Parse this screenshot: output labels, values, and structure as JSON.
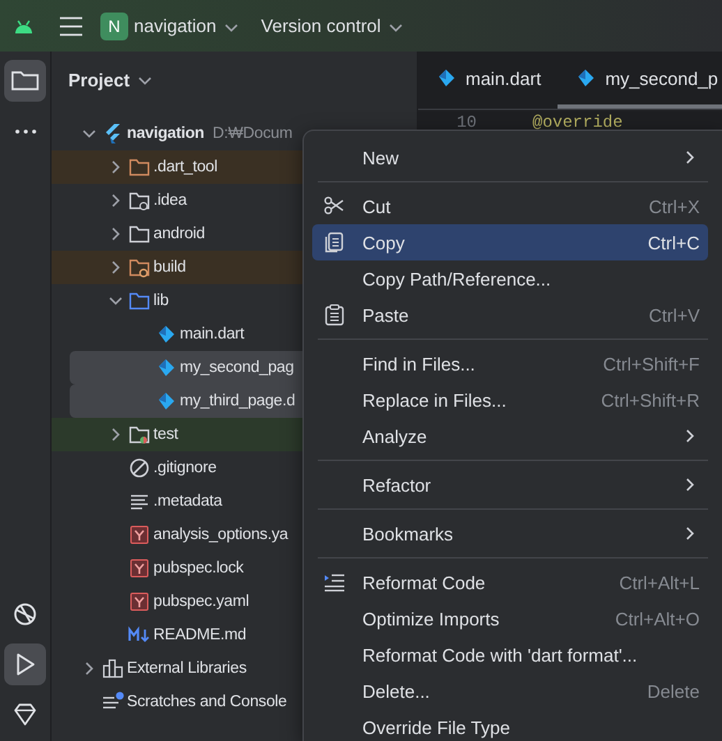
{
  "top_bar": {
    "project_badge": "N",
    "project": "navigation",
    "vcs": "Version control"
  },
  "tool_strip": {
    "top": [
      {
        "kind": "folder",
        "selected": true
      },
      {
        "kind": "more",
        "selected": false
      }
    ],
    "bottom": [
      {
        "kind": "services",
        "selected": false
      },
      {
        "kind": "run",
        "selected": true
      },
      {
        "kind": "gem",
        "selected": false
      }
    ]
  },
  "project": {
    "title": "Project",
    "tree": [
      {
        "label": "navigation",
        "hint": "D:₩Docum",
        "kind": "project",
        "expanded": true,
        "selected": false,
        "excluded": false,
        "test_root": false,
        "children": [
          {
            "label": ".dart_tool",
            "kind": "folder-excluded",
            "expanded": false,
            "selected": false,
            "excluded": true,
            "test_root": false
          },
          {
            "label": ".idea",
            "kind": "folder-config",
            "expanded": false,
            "selected": false,
            "excluded": false,
            "test_root": false
          },
          {
            "label": "android",
            "kind": "folder",
            "expanded": false,
            "selected": false,
            "excluded": false,
            "test_root": false
          },
          {
            "label": "build",
            "kind": "folder-build",
            "expanded": false,
            "selected": false,
            "excluded": true,
            "test_root": false
          },
          {
            "label": "lib",
            "kind": "folder-source",
            "expanded": true,
            "selected": false,
            "excluded": false,
            "test_root": false,
            "children": [
              {
                "label": "main.dart",
                "kind": "dart",
                "selected": false,
                "excluded": false,
                "test_root": false
              },
              {
                "label": "my_second_pag",
                "kind": "dart",
                "selected": true,
                "excluded": false,
                "test_root": false
              },
              {
                "label": "my_third_page.d",
                "kind": "dart",
                "selected": true,
                "excluded": false,
                "test_root": false
              }
            ]
          },
          {
            "label": "test",
            "kind": "folder-test",
            "expanded": false,
            "selected": false,
            "excluded": false,
            "test_root": true
          },
          {
            "label": ".gitignore",
            "kind": "ignore",
            "selected": false,
            "excluded": false,
            "test_root": false
          },
          {
            "label": ".metadata",
            "kind": "text",
            "selected": false,
            "excluded": false,
            "test_root": false
          },
          {
            "label": "analysis_options.ya",
            "kind": "yaml",
            "selected": false,
            "excluded": false,
            "test_root": false
          },
          {
            "label": "pubspec.lock",
            "kind": "yaml",
            "selected": false,
            "excluded": false,
            "test_root": false
          },
          {
            "label": "pubspec.yaml",
            "kind": "yaml",
            "selected": false,
            "excluded": false,
            "test_root": false
          },
          {
            "label": "README.md",
            "kind": "markdown",
            "selected": false,
            "excluded": false,
            "test_root": false
          }
        ]
      },
      {
        "label": "External Libraries",
        "kind": "libraries",
        "expanded": false,
        "selected": false,
        "excluded": false,
        "test_root": false
      },
      {
        "label": "Scratches and Console",
        "kind": "scratches",
        "selected": false,
        "excluded": false,
        "test_root": false
      }
    ]
  },
  "editor": {
    "tabs": [
      {
        "label": "main.dart",
        "selected": false
      },
      {
        "label": "my_second_p",
        "selected": true
      }
    ],
    "lines": [
      {
        "number": "10",
        "code": "@override"
      }
    ]
  },
  "context_menu": {
    "items": [
      {
        "kind": "plain",
        "label": "New",
        "submenu": true,
        "selected": false
      },
      {
        "kind": "separator"
      },
      {
        "kind": "cut",
        "label": "Cut",
        "shortcut": "Ctrl+X",
        "selected": false
      },
      {
        "kind": "copy",
        "label": "Copy",
        "shortcut": "Ctrl+C",
        "selected": true
      },
      {
        "kind": "plain",
        "label": "Copy Path/Reference...",
        "selected": false
      },
      {
        "kind": "paste",
        "label": "Paste",
        "shortcut": "Ctrl+V",
        "selected": false
      },
      {
        "kind": "separator"
      },
      {
        "kind": "plain",
        "label": "Find in Files...",
        "shortcut": "Ctrl+Shift+F",
        "selected": false
      },
      {
        "kind": "plain",
        "label": "Replace in Files...",
        "shortcut": "Ctrl+Shift+R",
        "selected": false
      },
      {
        "kind": "plain",
        "label": "Analyze",
        "submenu": true,
        "selected": false
      },
      {
        "kind": "separator"
      },
      {
        "kind": "plain",
        "label": "Refactor",
        "submenu": true,
        "selected": false
      },
      {
        "kind": "separator"
      },
      {
        "kind": "plain",
        "label": "Bookmarks",
        "submenu": true,
        "selected": false
      },
      {
        "kind": "separator"
      },
      {
        "kind": "reformat",
        "label": "Reformat Code",
        "shortcut": "Ctrl+Alt+L",
        "selected": false
      },
      {
        "kind": "plain",
        "label": "Optimize Imports",
        "shortcut": "Ctrl+Alt+O",
        "selected": false
      },
      {
        "kind": "plain",
        "label": "Reformat Code with 'dart format'...",
        "selected": false
      },
      {
        "kind": "plain",
        "label": "Delete...",
        "shortcut": "Delete",
        "selected": false
      },
      {
        "kind": "plain",
        "label": "Override File Type",
        "selected": false
      }
    ]
  }
}
